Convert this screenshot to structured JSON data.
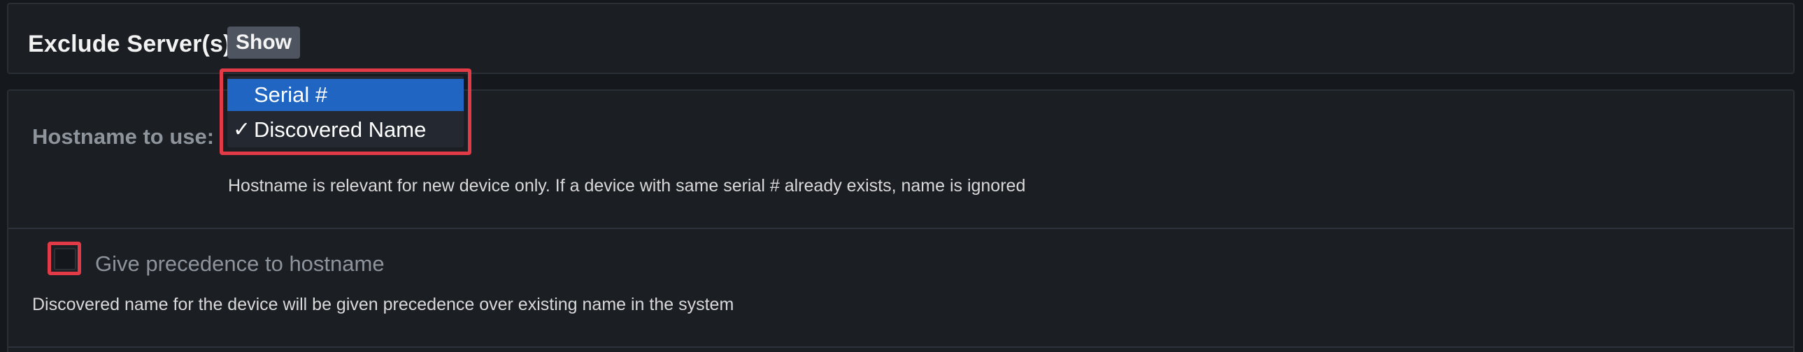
{
  "exclude_section": {
    "title": "Exclude Server(s)",
    "show_label": "Show"
  },
  "hostname": {
    "label": "Hostname to use:",
    "options": [
      {
        "label": "Serial #",
        "highlighted": true,
        "checked": false
      },
      {
        "label": "Discovered Name",
        "highlighted": false,
        "checked": true
      }
    ],
    "check_glyph": "✓",
    "help": "Hostname is relevant for new device only. If a device with same serial # already exists, name is ignored"
  },
  "precedence": {
    "checked": false,
    "label": "Give precedence to hostname",
    "help": "Discovered name for the device will be given precedence over existing name in the system"
  },
  "colors": {
    "highlight_border": "#e23a47",
    "selected_option_bg": "#1f65c1",
    "panel_bg": "#1b1e23"
  }
}
